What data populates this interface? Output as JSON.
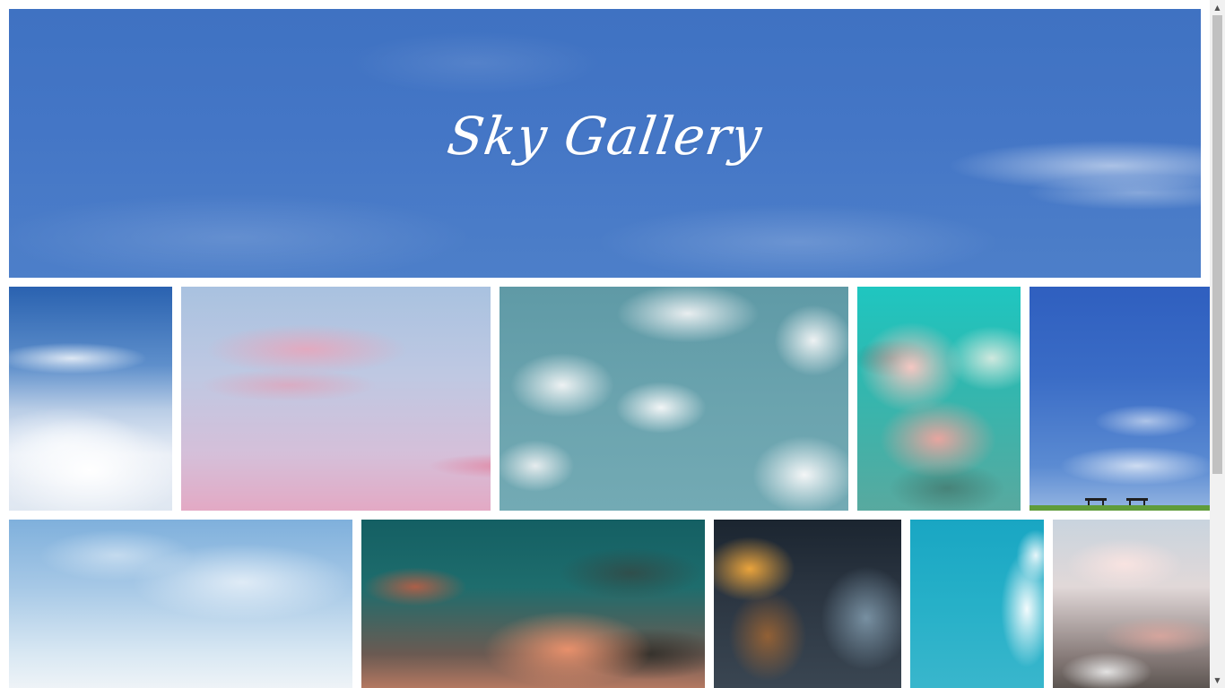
{
  "hero": {
    "title": "Sky Gallery"
  },
  "gallery": {
    "tiles": [
      {
        "name": "sky-photo-clouds-above"
      },
      {
        "name": "sky-photo-pink-sunset"
      },
      {
        "name": "sky-photo-teal-clouds"
      },
      {
        "name": "sky-photo-pink-cumulus"
      },
      {
        "name": "sky-photo-benches"
      },
      {
        "name": "sky-photo-light-blue"
      },
      {
        "name": "sky-photo-dusk-clouds"
      },
      {
        "name": "sky-photo-sunrays"
      },
      {
        "name": "sky-photo-cyan-cloud"
      },
      {
        "name": "sky-photo-pastel-clouds"
      }
    ]
  },
  "scrollbar": {
    "up_icon": "▲",
    "down_icon": "▼"
  },
  "colors": {
    "hero_blue": "#4476c6",
    "page_bg": "#ffffff",
    "title_color": "#ffffff"
  }
}
